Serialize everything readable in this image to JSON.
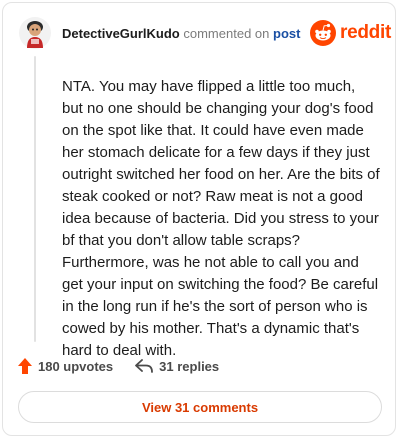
{
  "comment": {
    "username": "DetectiveGurlKudo",
    "action_text": "commented on",
    "post_link_label": "post",
    "body": "NTA. You may have flipped a little too much, but no one should be changing your dog's food on the spot like that. It could have even made her stomach delicate for a few days if they just outright switched her food on her. Are the bits of steak cooked or not? Raw meat is not a good idea because of bacteria. Did you stress to your bf that you don't allow table scraps? Furthermore, was he not able to call you and get your input on switching the food? Be careful in the long run if he's the sort of person who is cowed by his mother. That's a dynamic that's hard to deal with."
  },
  "brand": {
    "logo_text": "reddit",
    "logo_icon": "reddit-snoo-icon",
    "color": "#ff4500"
  },
  "stats": {
    "upvotes_label": "180 upvotes",
    "upvote_icon": "upvote-arrow-icon",
    "replies_label": "31 replies",
    "reply_icon": "reply-arrow-icon",
    "upvote_color": "#ff4500"
  },
  "actions": {
    "view_comments_label": "View 31 comments",
    "view_comments_color": "#d93a00"
  }
}
